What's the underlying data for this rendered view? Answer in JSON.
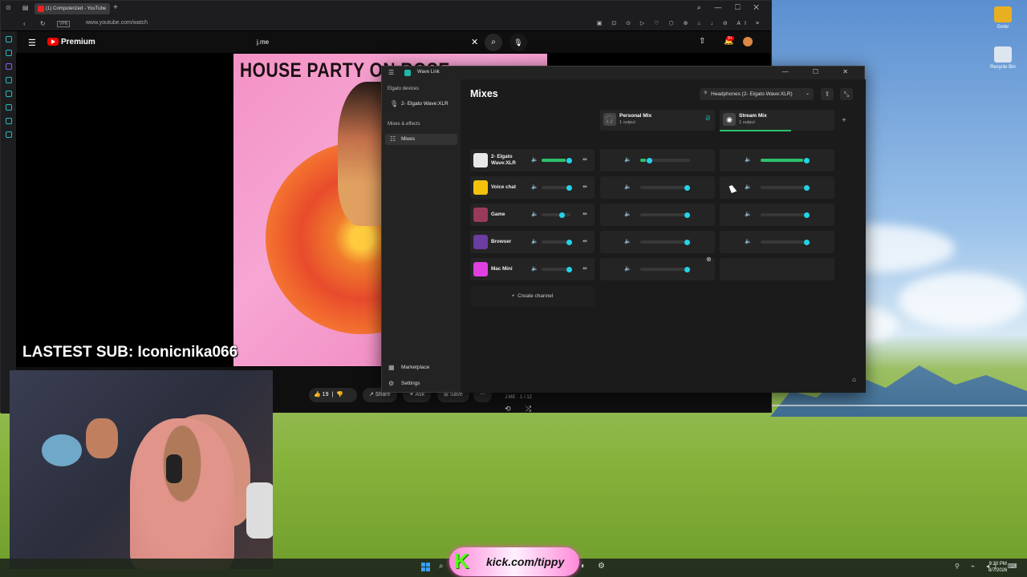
{
  "desktop": {
    "icons": [
      {
        "label": "Gmkr",
        "color": "#e8b020"
      },
      {
        "label": "Recycle Bin",
        "color": "#dde6ee"
      }
    ]
  },
  "browser": {
    "tab_title": "(1) Computerized - YouTube",
    "tab_plus": "+",
    "vpn": "VPN",
    "url": "www.youtube.com/watch",
    "ext_icons": "▣ ⊡ ⊙ ▷ ♡ ⬡ ⊕ ⌂ ↓ ⊘ AI ≡",
    "win_controls": "⌕ — ☐ ✕",
    "tab_left": "⊙ ▤"
  },
  "youtube": {
    "brand": "Premium",
    "search_value": "j.me",
    "clear": "✕",
    "search_icon": "⌕",
    "mic_icon": "🎙",
    "right_icons": "⇧ 🔔",
    "notif_count": "9+",
    "album_title": "HOUSE PARTY ON ROSE",
    "actions": {
      "likes": "19",
      "share": "Share",
      "ask": "Ask",
      "save": "Save",
      "more": "⋯"
    },
    "queue": "J.ME · 1 / 12"
  },
  "overlay": {
    "sub_banner": "LASTEST SUB: Iconicnika066",
    "kick_text": "kick.com/tippy"
  },
  "wavelink": {
    "title": "Wave Link",
    "controls": "— ☐ ✕",
    "sidebar": {
      "section_devices": "Elgato devices",
      "device": "2- Elgato Wave:XLR",
      "section_mixes": "Mixes & effects",
      "mixes_item": "Mixes",
      "marketplace": "Marketplace",
      "settings": "Settings"
    },
    "main": {
      "title": "Mixes",
      "output_device": "Headphones (2- Elgato Wave:XLR)",
      "create_channel": "Create channel",
      "mixes": [
        {
          "name": "Personal Mix",
          "sub": "1 output"
        },
        {
          "name": "Stream Mix",
          "sub": "1 output"
        }
      ],
      "channels": [
        {
          "name": "2- Elgato Wave:XLR",
          "icon_color": "#e8e8e8",
          "local": 0.95,
          "personal": 0.18,
          "stream": 0.95,
          "has_stream": true,
          "meters": true
        },
        {
          "name": "Voice chat",
          "icon_color": "#f4c20d",
          "local": 0.95,
          "personal": 0.95,
          "stream": 0.95,
          "has_stream": true,
          "meters": false
        },
        {
          "name": "Game",
          "icon_color": "#9a3a5a",
          "local": 0.7,
          "personal": 0.95,
          "stream": 0.95,
          "has_stream": true,
          "meters": false
        },
        {
          "name": "Browser",
          "icon_color": "#6a3da0",
          "local": 0.95,
          "personal": 0.95,
          "stream": 0.95,
          "has_stream": true,
          "meters": false
        },
        {
          "name": "Mac Mini",
          "icon_color": "#e040e0",
          "local": 0.95,
          "personal": 0.95,
          "stream": 0,
          "has_stream": false,
          "meters": false
        }
      ]
    }
  },
  "taskbar": {
    "time": "9:20 PM",
    "date": "8/7/2026"
  },
  "colors": {
    "accent_knob": "#22d3e8",
    "meter_green": "#2ec06c"
  }
}
